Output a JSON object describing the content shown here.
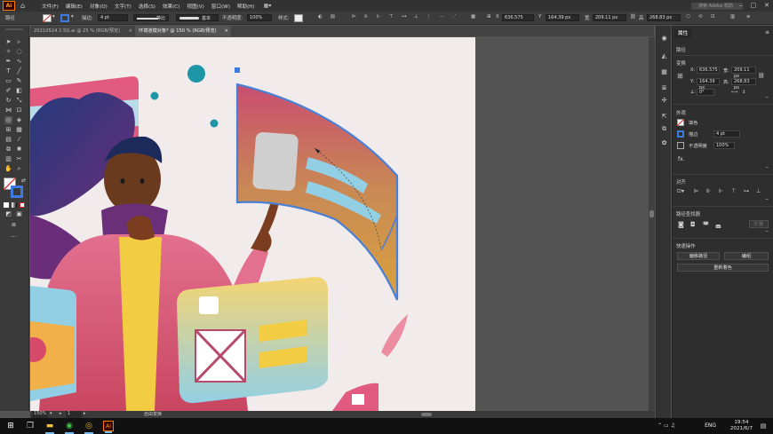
{
  "app": {
    "logo": "Ai",
    "layout_switcher": "▦▾",
    "search_placeholder": "搜索 Adobe 帮助"
  },
  "menu": [
    "文件(F)",
    "编辑(E)",
    "对象(O)",
    "文字(T)",
    "选择(S)",
    "效果(C)",
    "视图(V)",
    "窗口(W)",
    "帮助(H)"
  ],
  "control_bar": {
    "selection": "路径",
    "stroke_label": "描边:",
    "stroke_width": "4 pt",
    "profile": "等比",
    "brush": "基本",
    "opacity_label": "不透明度:",
    "opacity": "100%",
    "style_label": "样式:",
    "x": "636.575",
    "y": "164.39 px",
    "w": "209.11 px",
    "h": "268.83 px"
  },
  "tabs": [
    {
      "title": "20210524 2.5D.ai @ 25 % (RGB/预览)",
      "close": "×"
    },
    {
      "title": "环境道模对象* @ 150 % (RGB/预览)",
      "close": "×",
      "active": true
    }
  ],
  "status": {
    "zoom": "150%",
    "artboard": "1",
    "message": "自由变换"
  },
  "properties": {
    "tab_label": "属性",
    "path_label": "路径",
    "transform_label": "变换",
    "x": "636.575",
    "y": "164.39 px",
    "w": "209.11 px",
    "h": "268.83 px",
    "angle": "0°",
    "appearance_label": "外观",
    "fill_label": "填色",
    "stroke_label": "描边",
    "stroke_width": "4 pt",
    "opacity_label": "不透明度",
    "opacity": "100%",
    "fx": "fx.",
    "align_label": "对齐",
    "pathfinder_label": "路径查找器",
    "expand_label": "扩展",
    "quick_actions_label": "快速操作",
    "offset_path": "偏移路径",
    "edit": "编组",
    "recolor": "重新着色"
  },
  "taskbar": {
    "lang": "ENG",
    "time": "19:54",
    "date": "2021/6/7"
  },
  "colors": {
    "accent": "#3d7be0",
    "selection": "#4a7fd4",
    "artboard": "#f1ebec"
  }
}
